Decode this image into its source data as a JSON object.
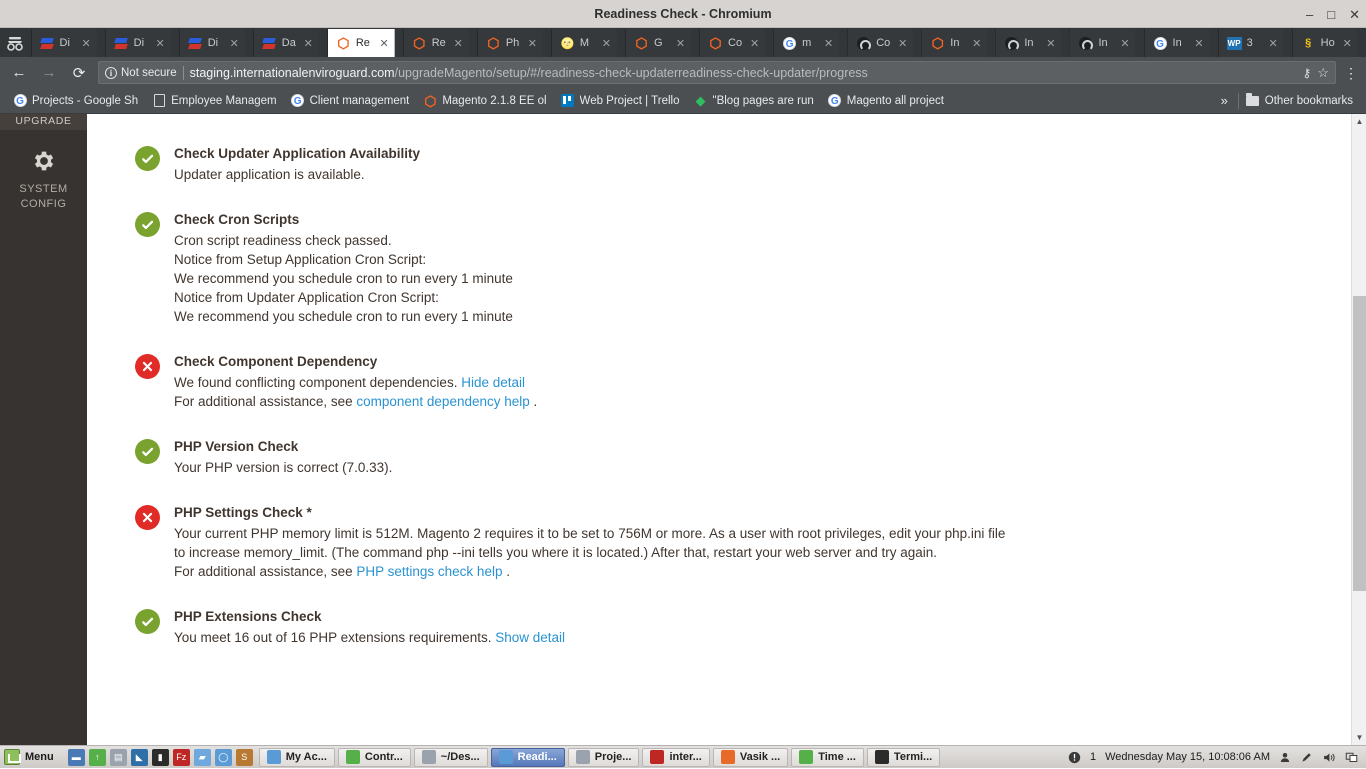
{
  "window": {
    "title": "Readiness Check - Chromium",
    "controls": {
      "minimize": "–",
      "maximize": "□",
      "close": "✕"
    }
  },
  "tabs": [
    {
      "favicon": "doc-icon",
      "title": "Di",
      "close": "✕"
    },
    {
      "favicon": "doc-icon",
      "title": "Di",
      "close": "✕"
    },
    {
      "favicon": "doc-icon",
      "title": "Di",
      "close": "✕"
    },
    {
      "favicon": "doc-icon",
      "title": "Da",
      "close": "✕"
    },
    {
      "favicon": "magento-icon",
      "title": "Re",
      "close": "✕",
      "active": true
    },
    {
      "favicon": "magento-icon",
      "title": "Re",
      "close": "✕"
    },
    {
      "favicon": "magento-icon",
      "title": "Ph",
      "close": "✕"
    },
    {
      "favicon": "emoji-icon",
      "title": "M",
      "close": "✕"
    },
    {
      "favicon": "magento-icon",
      "title": "G",
      "close": "✕"
    },
    {
      "favicon": "magento-icon",
      "title": "Co",
      "close": "✕"
    },
    {
      "favicon": "google-icon",
      "title": "m",
      "close": "✕"
    },
    {
      "favicon": "github-icon",
      "title": "Co",
      "close": "✕"
    },
    {
      "favicon": "magento-icon",
      "title": "In",
      "close": "✕"
    },
    {
      "favicon": "github-icon",
      "title": "In",
      "close": "✕"
    },
    {
      "favicon": "github-icon",
      "title": "In",
      "close": "✕"
    },
    {
      "favicon": "google-icon",
      "title": "In",
      "close": "✕"
    },
    {
      "favicon": "wordpress-icon",
      "title": "3",
      "close": "✕"
    },
    {
      "favicon": "php-icon",
      "title": "Ho",
      "close": "✕"
    }
  ],
  "toolbar": {
    "back": "←",
    "forward": "→",
    "reload": "⟳",
    "security_label": "Not secure",
    "security_icon": "info-circle-icon",
    "url_domain": "staging.internationalenviroguard.com",
    "url_path": "/upgradeMagento/setup/#/readiness-check-updaterreadiness-check-updater/progress",
    "key_icon": "⚷",
    "star_icon": "☆",
    "menu_icon": "⋮"
  },
  "bookmarks": {
    "items": [
      {
        "icon": "google-icon",
        "label": "Projects - Google Sh"
      },
      {
        "icon": "page-icon",
        "label": "Employee Managem"
      },
      {
        "icon": "google-icon",
        "label": "Client management"
      },
      {
        "icon": "magento-icon",
        "label": "Magento 2.1.8 EE ol"
      },
      {
        "icon": "trello-icon",
        "label": "Web Project | Trello"
      },
      {
        "icon": "evernote-icon",
        "label": "\"Blog pages are run"
      },
      {
        "icon": "google-icon",
        "label": "Magento all project"
      }
    ],
    "overflow": "»",
    "other_bookmarks": "Other bookmarks",
    "other_bookmarks_icon": "folder-icon"
  },
  "sidebar": {
    "partial_item": "UPGRADE",
    "items": [
      {
        "icon": "gear-icon",
        "line1": "SYSTEM",
        "line2": "CONFIG"
      }
    ]
  },
  "readiness": {
    "checks": [
      {
        "status": "ok",
        "status_icon": "check-circle-icon",
        "title": "Check Updater Application Availability",
        "text": "Updater application is available.",
        "extra": []
      },
      {
        "status": "ok",
        "status_icon": "check-circle-icon",
        "title": "Check Cron Scripts",
        "text": "Cron script readiness check passed.",
        "extra": [
          "Notice from Setup Application Cron Script:",
          "We recommend you schedule cron to run every 1 minute",
          "Notice from Updater Application Cron Script:",
          "We recommend you schedule cron to run every 1 minute"
        ]
      },
      {
        "status": "error",
        "status_icon": "x-circle-icon",
        "title": "Check Component Dependency",
        "text": "We found conflicting component dependencies.",
        "toggle_link": "Hide detail",
        "assist_prefix": "For additional assistance, see",
        "assist_link": "component dependency help",
        "assist_suffix": "."
      },
      {
        "status": "ok",
        "status_icon": "check-circle-icon",
        "title": "PHP Version Check",
        "text": "Your PHP version is correct (7.0.33)."
      },
      {
        "status": "error",
        "status_icon": "x-circle-icon",
        "title": "PHP Settings Check *",
        "text_line1": "Your current PHP memory limit is 512M. Magento 2 requires it to be set to 756M or more. As a user with root privileges, edit your php.ini file",
        "text_line2": "to increase memory_limit. (The command php --ini tells you where it is located.) After that, restart your web server and try again.",
        "assist_prefix": "For additional assistance, see",
        "assist_link": "PHP settings check help",
        "assist_suffix": "."
      },
      {
        "status": "ok",
        "status_icon": "check-circle-icon",
        "title": "PHP Extensions Check",
        "text": "You meet 16 out of 16 PHP extensions requirements.",
        "toggle_link": "Show detail"
      }
    ]
  },
  "scrollbar": {
    "up_arrow": "▲",
    "down_arrow": "▼"
  },
  "taskbar": {
    "menu_label": "Menu",
    "launchers": [
      {
        "name": "show-desktop-icon",
        "glyph": "▬",
        "color": "#4a7ab5"
      },
      {
        "name": "update-manager-icon",
        "glyph": "↑",
        "color": "#56b04a"
      },
      {
        "name": "image-viewer-icon",
        "glyph": "▤",
        "color": "#9aa3ad"
      },
      {
        "name": "vscode-icon",
        "glyph": "◣",
        "color": "#2f6fa8"
      },
      {
        "name": "terminal-icon",
        "glyph": "▮",
        "color": "#2b2b2b"
      },
      {
        "name": "filezilla-icon",
        "glyph": "Fz",
        "color": "#bf2724"
      },
      {
        "name": "file-manager-icon",
        "glyph": "▰",
        "color": "#6fa8dc"
      },
      {
        "name": "chromium-icon",
        "glyph": "◯",
        "color": "#5b9bd5"
      },
      {
        "name": "sublime-icon",
        "glyph": "S",
        "color": "#b87a33"
      }
    ],
    "tasks": [
      {
        "icon": "chromium-icon",
        "label": "My Ac...",
        "active": false,
        "color": "#5b9bd5"
      },
      {
        "icon": "update-manager-icon",
        "label": "Contr...",
        "active": false,
        "color": "#56b04a"
      },
      {
        "icon": "sublime-icon",
        "label": "~/Des...",
        "active": false,
        "color": "#9aa3ad"
      },
      {
        "icon": "chromium-icon",
        "label": "Readi...",
        "active": true,
        "color": "#5b9bd5"
      },
      {
        "icon": "image-viewer-icon",
        "label": "Proje...",
        "active": false,
        "color": "#9aa3ad"
      },
      {
        "icon": "filezilla-icon",
        "label": "inter...",
        "active": false,
        "color": "#bf2724"
      },
      {
        "icon": "firefox-icon",
        "label": "Vasik ...",
        "active": false,
        "color": "#e86a28"
      },
      {
        "icon": "update-manager-icon",
        "label": "Time ...",
        "active": false,
        "color": "#56b04a"
      },
      {
        "icon": "terminal-icon",
        "label": "Termi...",
        "active": false,
        "color": "#2b2b2b"
      }
    ],
    "tray": {
      "notification_icon": "!",
      "notification_count": "1",
      "clock": "Wednesday May 15, 10:08:06 AM",
      "user_icon": "user-icon",
      "pen_icon": "pen-icon",
      "volume_icon": "volume-icon",
      "workspace_icon": "workspace-icon"
    }
  }
}
